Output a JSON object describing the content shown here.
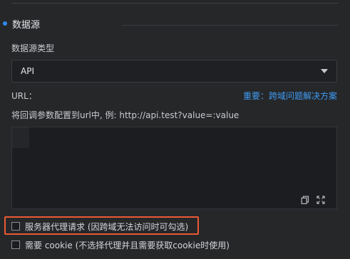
{
  "section": {
    "title": "数据源"
  },
  "source_type": {
    "label": "数据源类型",
    "selected": "API"
  },
  "url": {
    "label": "URL：",
    "cors_link": "重要：跨域问题解决方案",
    "hint": "将回调参数配置到url中, 例: http://api.test?value=:value"
  },
  "editor": {
    "icons": [
      "copy-icon",
      "fullscreen-icon"
    ]
  },
  "options": {
    "proxy_label": "服务器代理请求 (因跨域无法访问时可勾选)",
    "proxy_checked": false,
    "cookie_label": "需要 cookie (不选择代理并且需要获取cookie时使用)",
    "cookie_checked": false
  },
  "colors": {
    "background": "#262729",
    "accent": "#2d8cf0",
    "link": "#3f9cf5",
    "highlight_border": "#ea5a35"
  }
}
